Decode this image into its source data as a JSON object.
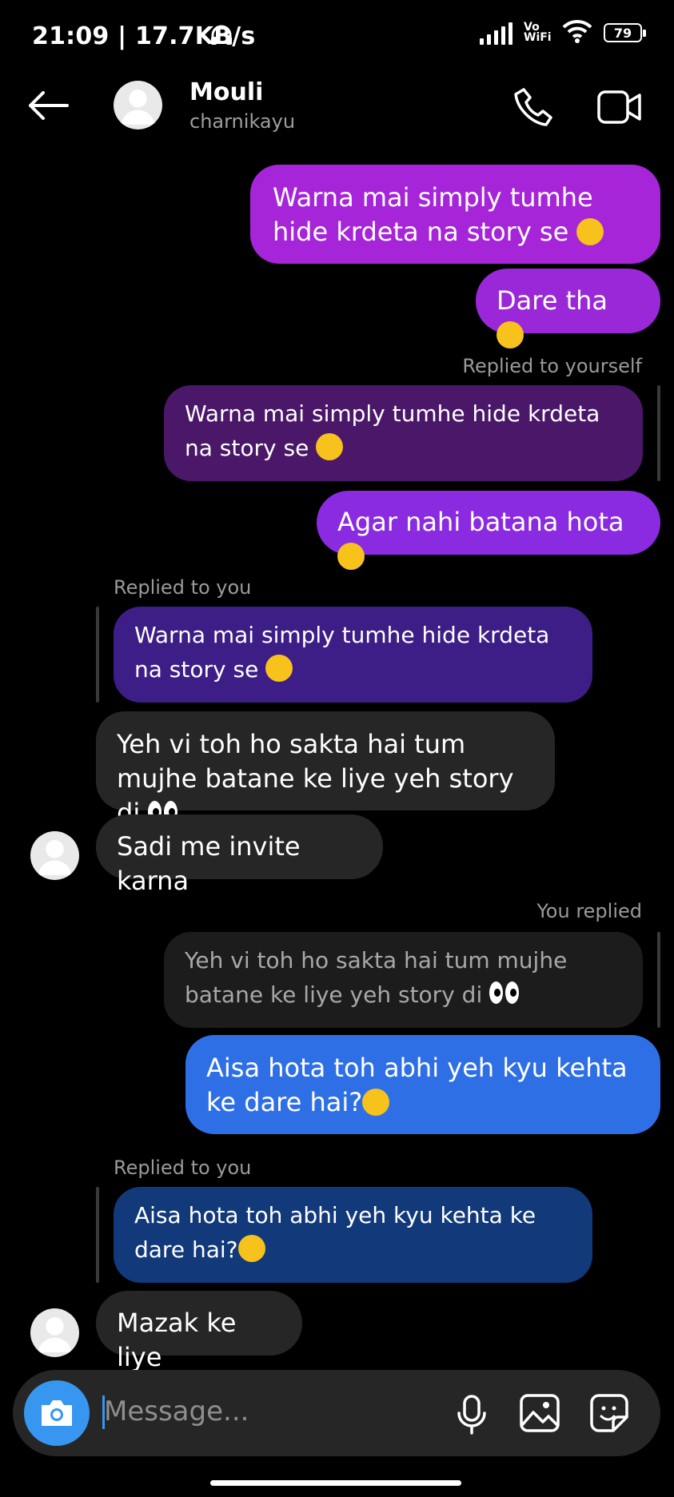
{
  "status_bar": {
    "time_speed": "21:09 | 17.7KB/s",
    "network": "Vo WiFi",
    "battery": "79"
  },
  "header": {
    "name": "Mouli",
    "handle": "charnikayu"
  },
  "messages": {
    "m1": "Warna mai simply tumhe hide krdeta na story se",
    "m2": "Dare tha",
    "reply1_label": "Replied to yourself",
    "reply1_quote": "Warna mai simply tumhe hide krdeta na story se",
    "m3": "Agar nahi batana hota",
    "reply2_label": "Replied to you",
    "reply2_quote": "Warna mai simply tumhe hide krdeta na story se",
    "m4": "Yeh vi toh ho sakta hai tum mujhe batane ke liye yeh story di",
    "m5": "Sadi me invite karna",
    "reply3_label": "You replied",
    "reply3_quote": "Yeh vi toh ho sakta hai tum mujhe batane ke liye yeh story di",
    "m6": "Aisa hota toh abhi yeh kyu kehta ke dare hai?",
    "reply4_label": "Replied to you",
    "reply4_quote": "Aisa hota toh abhi yeh kyu kehta ke dare hai?",
    "m7": "Mazak ke liye"
  },
  "composer": {
    "placeholder": "Message..."
  },
  "colors": {
    "sent_purple": "#a625d8",
    "sent_violet": "#8a2be2",
    "sent_blue": "#2f6fe6",
    "received": "#262626",
    "quote_purple": "#4a1769",
    "quote_indigo": "#3c1e86",
    "quote_navy": "#123a7a",
    "accent": "#3797f0"
  },
  "icons": [
    "back-arrow-icon",
    "phone-icon",
    "video-call-icon",
    "camera-icon",
    "microphone-icon",
    "gallery-icon",
    "sticker-icon"
  ]
}
